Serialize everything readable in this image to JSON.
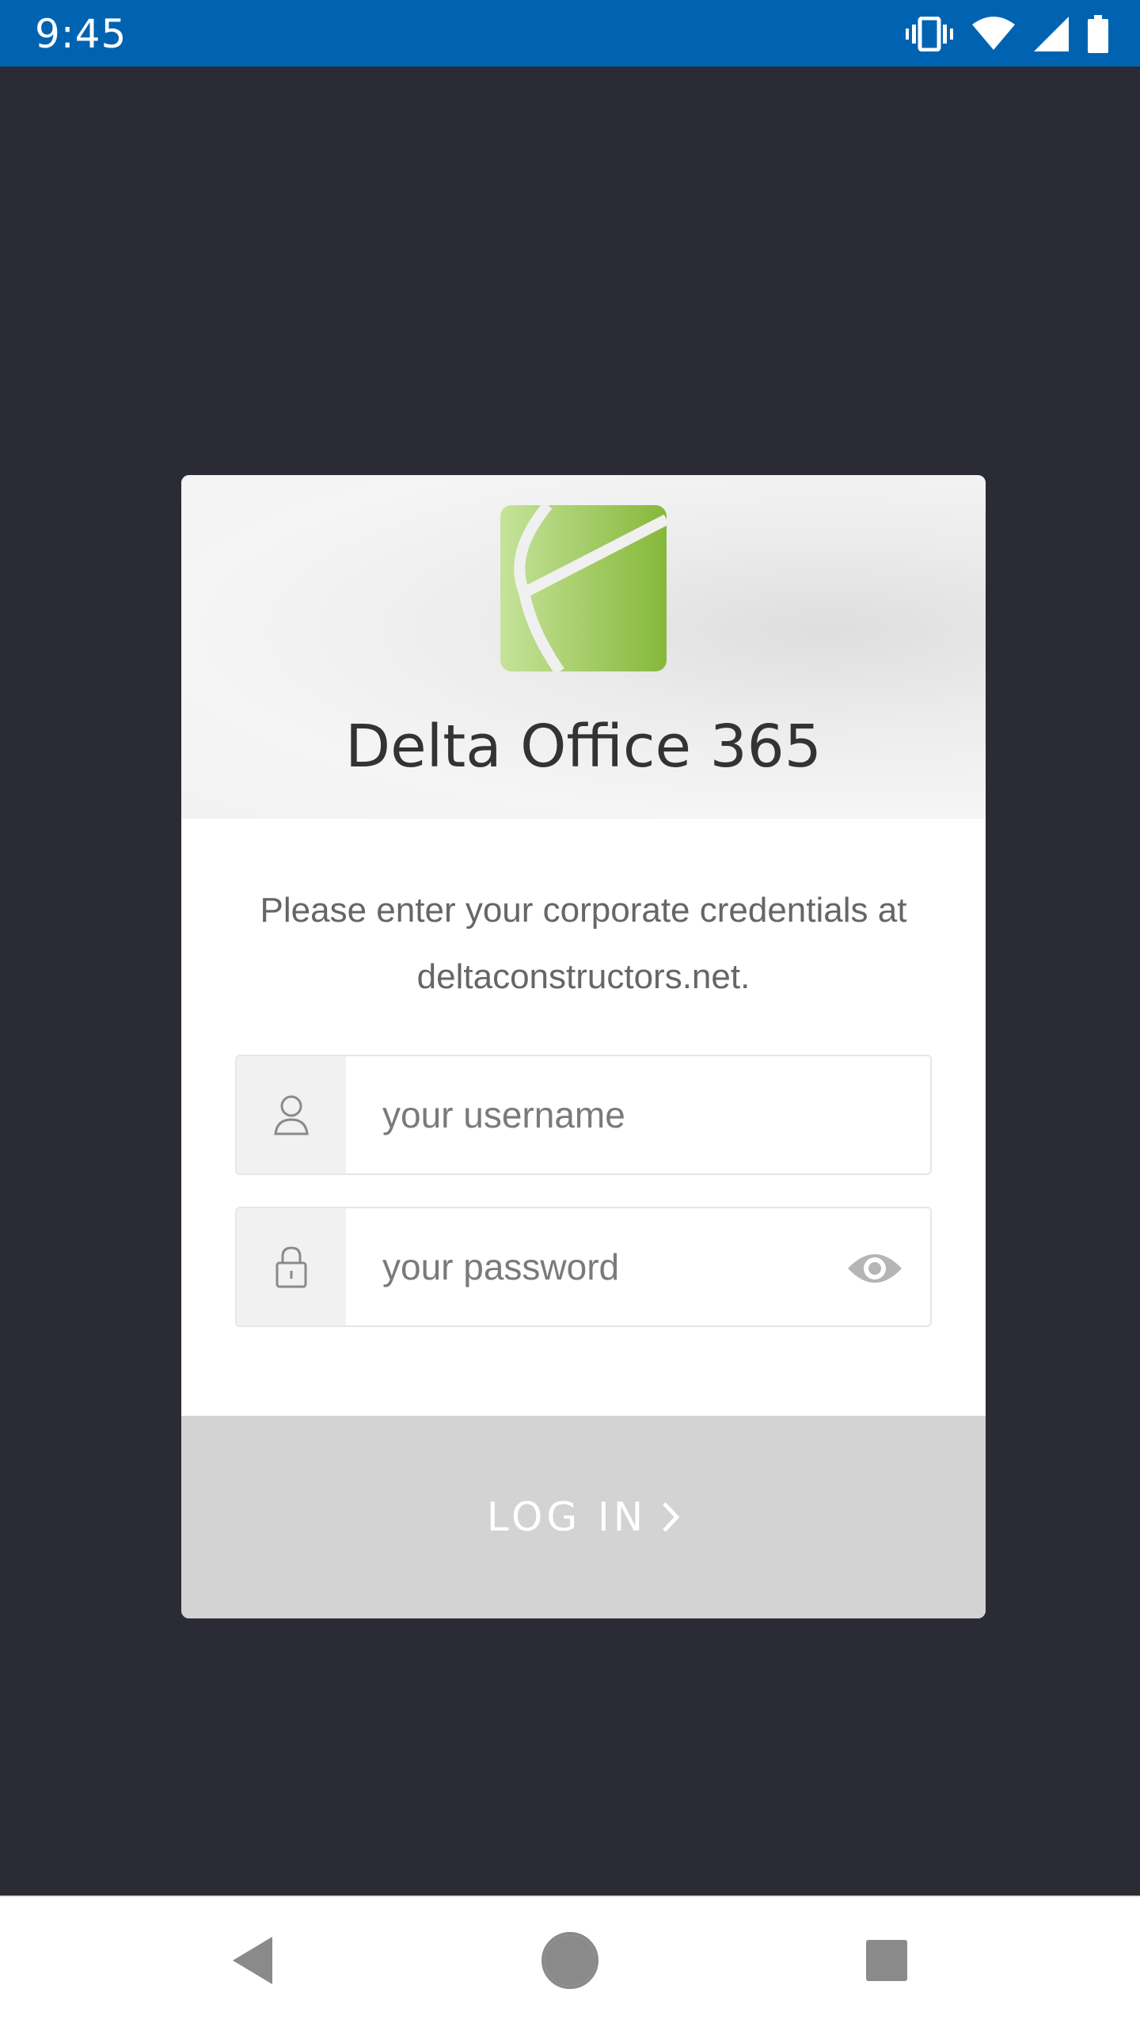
{
  "status_bar": {
    "time": "9:45",
    "icons": [
      "vibrate-icon",
      "wifi-icon",
      "cell-signal-icon",
      "battery-icon"
    ],
    "background": "#0063b1"
  },
  "login": {
    "app_title": "Delta Office 365",
    "instructions": "Please enter your corporate credentials at deltaconstructors.net.",
    "username_placeholder": "your username",
    "password_placeholder": "your password",
    "login_label": "LOG IN",
    "logo_icon": "delta-logo-icon",
    "brand_green": "#8cbf3f",
    "button_color": "#d3d3d3"
  },
  "nav_bar": {
    "buttons": [
      "back-icon",
      "home-icon",
      "recents-icon"
    ]
  }
}
